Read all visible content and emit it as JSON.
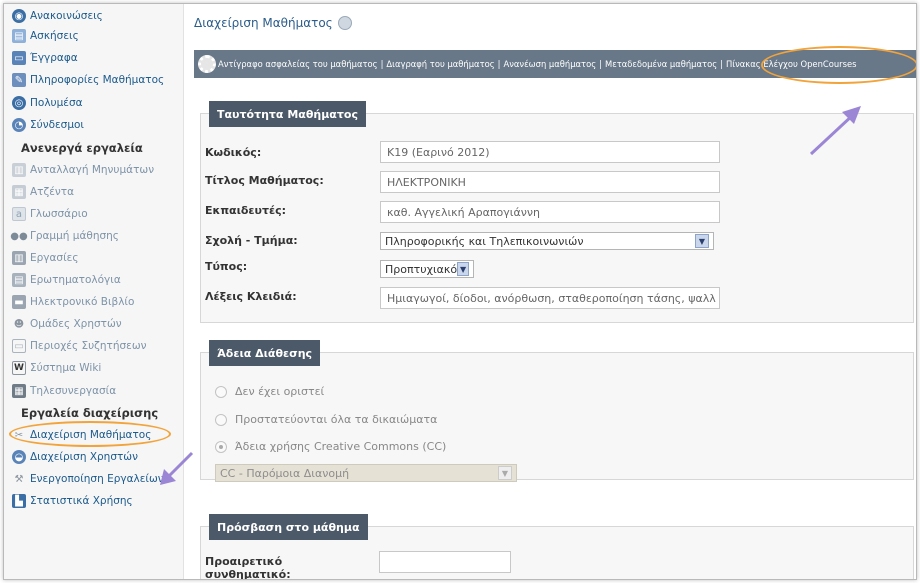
{
  "sidebar": {
    "items_top": [
      {
        "label": "Ανακοινώσεις",
        "icon": "announcements-icon"
      },
      {
        "label": "Ασκήσεις",
        "icon": "exercises-icon"
      },
      {
        "label": "Έγγραφα",
        "icon": "documents-icon"
      },
      {
        "label": "Πληροφορίες Μαθήματος",
        "icon": "course-info-icon"
      },
      {
        "label": "Πολυμέσα",
        "icon": "multimedia-icon"
      },
      {
        "label": "Σύνδεσμοι",
        "icon": "links-icon"
      }
    ],
    "inactive_heading": "Ανενεργά εργαλεία",
    "items_inactive": [
      {
        "label": "Ανταλλαγή Μηνυμάτων",
        "icon": "messages-icon"
      },
      {
        "label": "Ατζέντα",
        "icon": "agenda-icon"
      },
      {
        "label": "Γλωσσάριο",
        "icon": "glossary-icon"
      },
      {
        "label": "Γραμμή μάθησης",
        "icon": "learning-path-icon"
      },
      {
        "label": "Εργασίες",
        "icon": "assignments-icon"
      },
      {
        "label": "Ερωτηματολόγια",
        "icon": "questionnaire-icon"
      },
      {
        "label": "Ηλεκτρονικό Βιβλίο",
        "icon": "ebook-icon"
      },
      {
        "label": "Ομάδες Χρηστών",
        "icon": "user-groups-icon"
      },
      {
        "label": "Περιοχές Συζητήσεων",
        "icon": "forum-icon"
      },
      {
        "label": "Σύστημα Wiki",
        "icon": "wiki-icon"
      },
      {
        "label": "Τηλεσυνεργασία",
        "icon": "teleconference-icon"
      }
    ],
    "admin_heading": "Εργαλεία διαχείρισης",
    "items_admin": [
      {
        "label": "Διαχείριση Μαθήματος",
        "icon": "course-admin-icon"
      },
      {
        "label": "Διαχείριση Χρηστών",
        "icon": "user-admin-icon"
      },
      {
        "label": "Ενεργοποίηση Εργαλείων",
        "icon": "tools-activation-icon"
      },
      {
        "label": "Στατιστικά Χρήσης",
        "icon": "statistics-icon"
      }
    ]
  },
  "page": {
    "title": "Διαχείριση Μαθήματος"
  },
  "toolbar": {
    "links": [
      "Αντίγραφο ασφαλείας του μαθήματος",
      "Διαγραφή του μαθήματος",
      "Ανανέωση μαθήματος",
      "Μεταδεδομένα μαθήματος",
      "Πίνακας Ελέγχου OpenCourses"
    ],
    "separator": "|"
  },
  "identity": {
    "legend": "Ταυτότητα Μαθήματος",
    "code_label": "Κωδικός:",
    "code_value": "K19 (Εαρινό 2012)",
    "title_label": "Τίτλος Μαθήματος:",
    "title_value": "ΗΛΕΚΤΡΟΝΙΚΗ",
    "instructors_label": "Εκπαιδευτές:",
    "instructors_value": "καθ. Αγγελική Αραπογιάννη",
    "school_label": "Σχολή - Τμήμα:",
    "school_value": "Πληροφορικής και Τηλεπικοινωνιών",
    "type_label": "Τύπος:",
    "type_value": "Προπτυχιακό",
    "keywords_label": "Λέξεις Κλειδιά:",
    "keywords_value": "Ημιαγωγοί, δίοδοι, ανόρθωση, σταθεροποίηση τάσης, ψαλλ"
  },
  "license": {
    "legend": "Άδεια Διάθεσης",
    "options": [
      "Δεν έχει οριστεί",
      "Προστατεύονται όλα τα δικαιώματα",
      "Άδεια χρήσης Creative Commons (CC)"
    ],
    "selected_index": 2,
    "cc_select_value": "CC - Παρόμοια Διανομή"
  },
  "access": {
    "legend": "Πρόσβαση στο μάθημα",
    "password_label": "Προαιρετικό συνθηματικό:",
    "password_value": ""
  },
  "colors": {
    "toolbar_bg": "#687888",
    "legend_bg": "#4c5968",
    "link": "#1c5a8c",
    "highlight_oval": "#f2a33a",
    "arrow": "#9b86d6"
  }
}
